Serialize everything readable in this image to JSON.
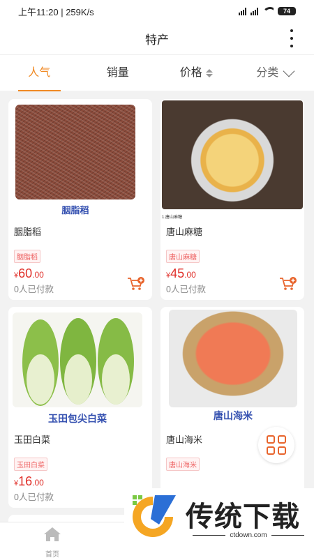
{
  "status_bar": {
    "time": "上午11:20",
    "speed": "259K/s",
    "battery": "74"
  },
  "header": {
    "title": "特产"
  },
  "tabs": [
    {
      "label": "人气"
    },
    {
      "label": "销量"
    },
    {
      "label": "价格"
    },
    {
      "label": "分类"
    }
  ],
  "products": [
    {
      "image_caption": "胭脂稻",
      "name": "胭脂稻",
      "tag": "胭脂稻",
      "currency": "¥",
      "price_int": "60",
      "price_dec": ".00",
      "sold": "0人已付款"
    },
    {
      "image_caption": "1.唐山麻糖",
      "name": "唐山麻糖",
      "tag": "唐山麻糖",
      "currency": "¥",
      "price_int": "45",
      "price_dec": ".00",
      "sold": "0人已付款"
    },
    {
      "image_caption": "玉田包尖白菜",
      "name": "玉田白菜",
      "tag": "玉田白菜",
      "currency": "¥",
      "price_int": "16",
      "price_dec": ".00",
      "sold": "0人已付款"
    },
    {
      "image_caption": "唐山海米",
      "name": "唐山海米",
      "tag": "唐山海米"
    }
  ],
  "bottom_nav": {
    "home_label": "首页"
  },
  "watermark": {
    "title": "传统下载",
    "url": "ctdown.com"
  },
  "colors": {
    "accent": "#f08a24",
    "price": "#e0302a"
  }
}
